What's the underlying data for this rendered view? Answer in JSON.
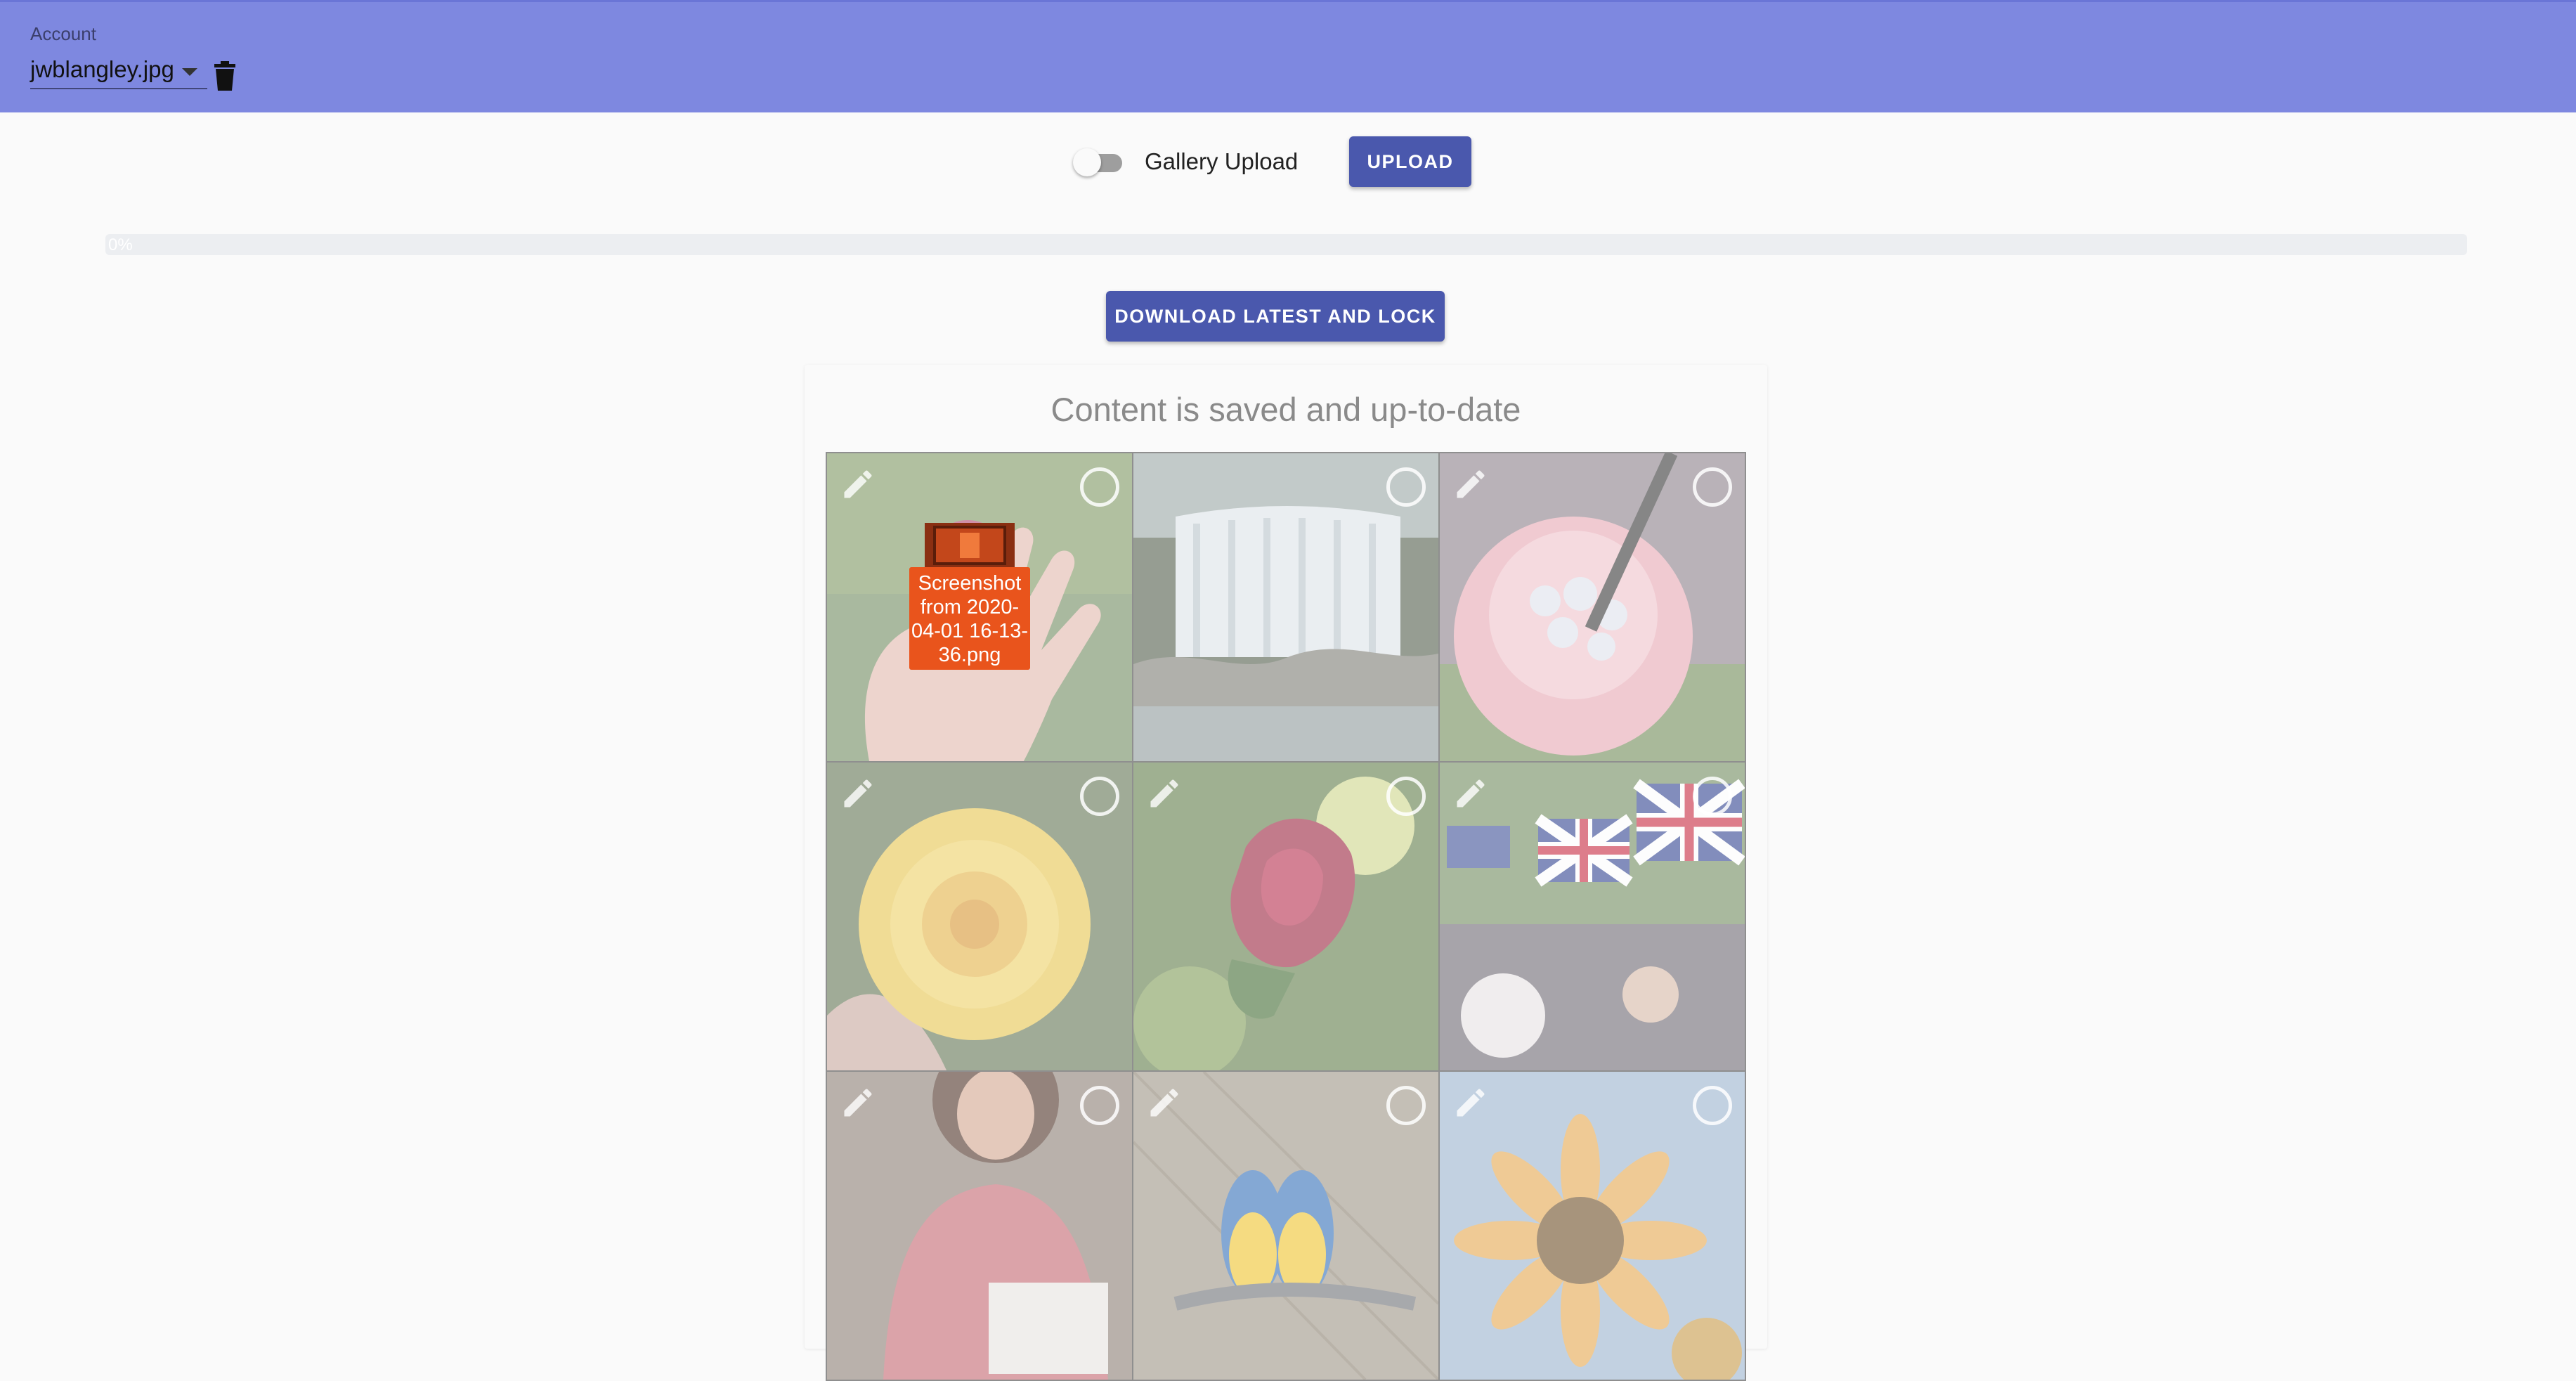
{
  "header": {
    "account_label": "Account",
    "account_value": "jwblangley.jpg",
    "bar_color": "#7e88e0"
  },
  "toolbar": {
    "gallery_toggle_label": "Gallery Upload",
    "gallery_toggle_on": false,
    "upload_label": "UPLOAD"
  },
  "progress": {
    "value": 0,
    "text": "0%"
  },
  "actions": {
    "download_label": "DOWNLOAD LATEST AND LOCK"
  },
  "content": {
    "status_text": "Content is saved and up-to-date"
  },
  "gallery": {
    "tiles": [
      {
        "subject": "hand-holding-flower"
      },
      {
        "subject": "waterfall"
      },
      {
        "subject": "pink-drink-with-straw"
      },
      {
        "subject": "yellow-rose"
      },
      {
        "subject": "red-rose"
      },
      {
        "subject": "union-jack-crowd"
      },
      {
        "subject": "woman-reading"
      },
      {
        "subject": "macaw-parrots"
      },
      {
        "subject": "sunflower"
      }
    ]
  },
  "drag_ghost": {
    "filename": "Screenshot from 2020-04-01 16-13-36.png"
  },
  "colors": {
    "primary_button": "#4a58ad",
    "drag_label": "#e9541c"
  }
}
